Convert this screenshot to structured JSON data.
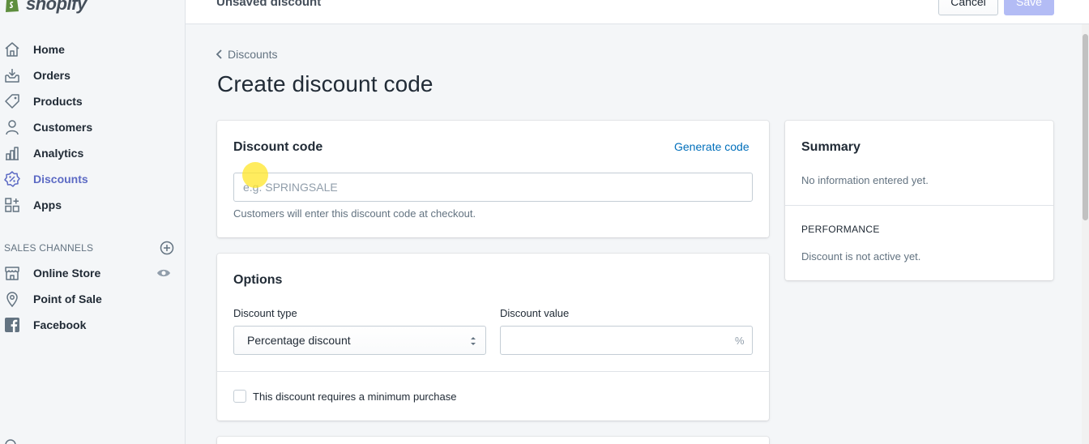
{
  "brand": {
    "name": "shopify",
    "color": "#95bf47"
  },
  "topbar": {
    "title": "Unsaved discount",
    "cancel_label": "Cancel",
    "save_label": "Save"
  },
  "nav": {
    "items": [
      {
        "label": "Home",
        "icon": "home-icon"
      },
      {
        "label": "Orders",
        "icon": "orders-icon"
      },
      {
        "label": "Products",
        "icon": "tag-icon"
      },
      {
        "label": "Customers",
        "icon": "person-icon"
      },
      {
        "label": "Analytics",
        "icon": "bar-chart-icon"
      },
      {
        "label": "Discounts",
        "icon": "discount-icon",
        "active": true
      },
      {
        "label": "Apps",
        "icon": "apps-icon"
      }
    ],
    "channels_title": "SALES CHANNELS",
    "channels": [
      {
        "label": "Online Store",
        "icon": "store-icon"
      },
      {
        "label": "Point of Sale",
        "icon": "location-pin-icon"
      },
      {
        "label": "Facebook",
        "icon": "facebook-icon"
      }
    ]
  },
  "breadcrumb": {
    "label": "Discounts"
  },
  "page_title": "Create discount code",
  "code_card": {
    "heading": "Discount code",
    "generate_label": "Generate code",
    "input_value": "",
    "input_placeholder": "e.g. SPRINGSALE",
    "help": "Customers will enter this discount code at checkout."
  },
  "options_card": {
    "heading": "Options",
    "type_label": "Discount type",
    "type_value": "Percentage discount",
    "value_label": "Discount value",
    "value_value": "",
    "value_suffix": "%",
    "min_purchase_label": "This discount requires a minimum purchase",
    "min_purchase_checked": false
  },
  "summary_card": {
    "heading": "Summary",
    "summary_text": "No information entered yet.",
    "performance_title": "PERFORMANCE",
    "performance_text": "Discount is not active yet."
  },
  "colors": {
    "accent": "#5c6ac4",
    "link": "#006fbb",
    "save_disabled": "#b3bcf5"
  }
}
